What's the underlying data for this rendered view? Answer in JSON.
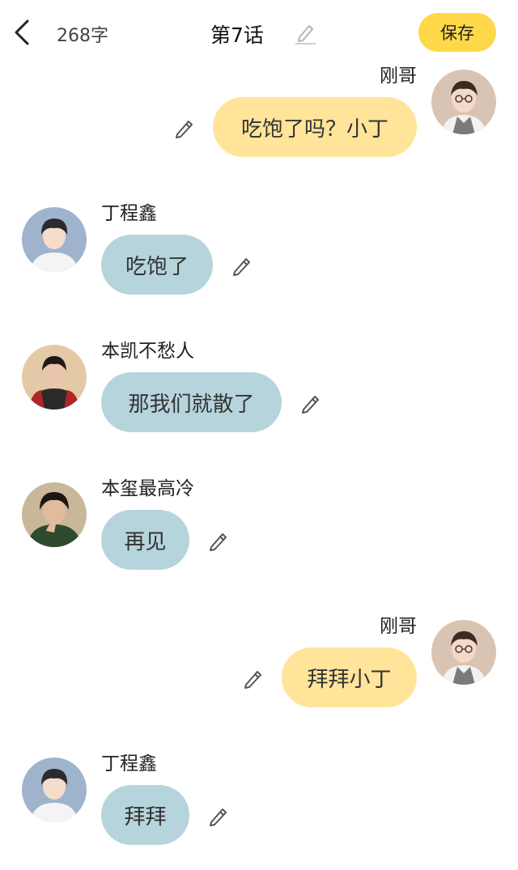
{
  "header": {
    "back_icon": "chevron-left-icon",
    "word_count": "268字",
    "title": "第7话",
    "edit_icon": "pencil-icon",
    "save_label": "保存",
    "save_color": "#ffd84a"
  },
  "messages": [
    {
      "side": "right",
      "name": "刚哥",
      "text": "吃饱了吗？小丁",
      "bubble_color": "#ffe49a"
    },
    {
      "side": "left",
      "name": "丁程鑫",
      "text": "吃饱了",
      "bubble_color": "#b6d4dc"
    },
    {
      "side": "left",
      "name": "本凯不愁人",
      "text": "那我们就散了",
      "bubble_color": "#b6d4dc"
    },
    {
      "side": "left",
      "name": "本玺最高冷",
      "text": "再见",
      "bubble_color": "#b6d4dc"
    },
    {
      "side": "right",
      "name": "刚哥",
      "text": "拜拜小丁",
      "bubble_color": "#ffe49a"
    },
    {
      "side": "left",
      "name": "丁程鑫",
      "text": "拜拜",
      "bubble_color": "#b6d4dc"
    }
  ]
}
